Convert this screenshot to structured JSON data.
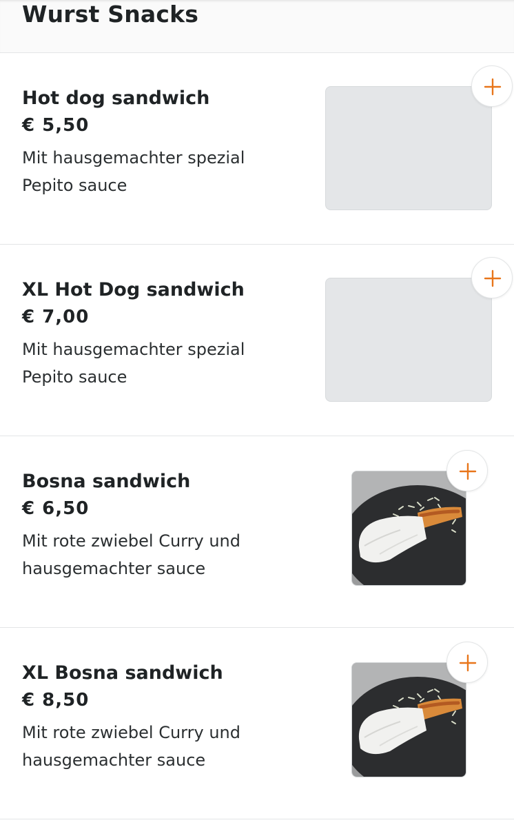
{
  "section": {
    "title": "Wurst Snacks"
  },
  "items": [
    {
      "name": "Hot dog sandwich",
      "price": "€ 5,50",
      "desc_line1": "Mit hausgemachter spezial",
      "desc_line2": "Pepito sauce",
      "image": "placeholder"
    },
    {
      "name": "XL Hot Dog sandwich",
      "price": "€ 7,00",
      "desc_line1": "Mit hausgemachter spezial",
      "desc_line2": "Pepito sauce",
      "image": "placeholder"
    },
    {
      "name": "Bosna sandwich",
      "price": "€ 6,50",
      "desc_line1": "Mit rote zwiebel  Curry und",
      "desc_line2": "hausgemachter  sauce",
      "image": "photo"
    },
    {
      "name": "XL Bosna sandwich",
      "price": "€ 8,50",
      "desc_line1": "Mit rote zwiebel  Curry und",
      "desc_line2": "hausgemachter sauce",
      "image": "photo"
    }
  ],
  "icons": {
    "add": "plus-icon",
    "food_photo": "bosna-sandwich-photo"
  },
  "colors": {
    "accent": "#e8751a",
    "placeholder": "#e4e6e8",
    "text": "#1f2325"
  }
}
